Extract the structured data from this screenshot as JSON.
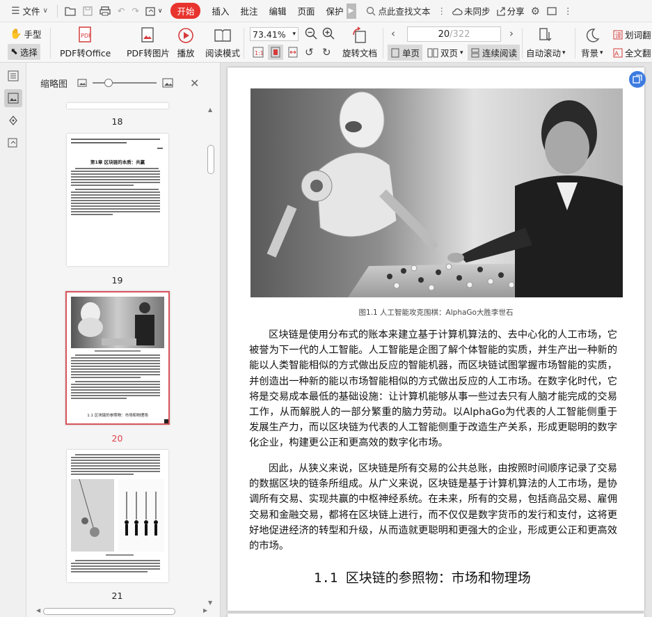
{
  "menubar": {
    "file_label": "文件",
    "start_label": "开始",
    "insert_label": "插入",
    "annotate_label": "批注",
    "edit_label": "编辑",
    "page_label": "页面",
    "protect_label": "保护",
    "search_placeholder": "点此查找文本",
    "sync_label": "未同步",
    "share_label": "分享"
  },
  "toolbar": {
    "hand_label": "手型",
    "select_label": "选择",
    "pdf_to_office_label": "PDF转Office",
    "pdf_to_image_label": "PDF转图片",
    "play_label": "播放",
    "read_mode_label": "阅读模式",
    "zoom_value": "73.41%",
    "rotate_label": "旋转文档",
    "page_current": "20",
    "page_total": "/322",
    "single_page_label": "单页",
    "double_page_label": "双页",
    "continuous_label": "连续阅读",
    "auto_scroll_label": "自动滚动",
    "background_label": "背景",
    "translate_word_label": "划词翻",
    "full_text_label": "全文翻"
  },
  "thumbnails": {
    "panel_title": "缩略图",
    "pages": [
      "18",
      "19",
      "20",
      "21"
    ],
    "thumb19_chapter": "第1章  区块链的本质：共赢",
    "thumb20_heading": "1.1  区块链的参照物：市场和物理场"
  },
  "document": {
    "figure_caption": "图1.1  人工智能攻克围棋：AlphaGo大胜李世石",
    "paragraphs": [
      "区块链是使用分布式的账本来建立基于计算机算法的、去中心化的人工市场，它被誉为下一代的人工智能。人工智能是企图了解个体智能的实质，并生产出一种新的能以人类智能相似的方式做出反应的智能机器，而区块链试图掌握市场智能的实质，并创造出一种新的能以市场智能相似的方式做出反应的人工市场。在数字化时代，它将是交易成本最低的基础设施：让计算机能够从事一些过去只有人脑才能完成的交易工作，从而解脱人的一部分繁重的脑力劳动。以AlphaGo为代表的人工智能侧重于发展生产力，而以区块链为代表的人工智能侧重于改造生产关系，形成更聪明的数字化企业，构建更公正和更高效的数字化市场。",
      "因此，从狭义来说，区块链是所有交易的公共总账，由按照时间顺序记录了交易的数据区块的链条所组成。从广义来说，区块链是基于计算机算法的人工市场，是协调所有交易、实现共赢的中枢神经系统。在未来，所有的交易，包括商品交易、雇佣交易和金融交易，都将在区块链上进行，而不仅仅是数字货币的发行和支付，这将更好地促进经济的转型和升级，从而造就更聪明和更强大的企业，形成更公正和更高效的市场。"
    ],
    "section_heading": "1.1  区块链的参照物：市场和物理场"
  },
  "colors": {
    "accent_red": "#e8342e",
    "active_page_number": "#e0404a",
    "fab_blue": "#3d7be0"
  }
}
